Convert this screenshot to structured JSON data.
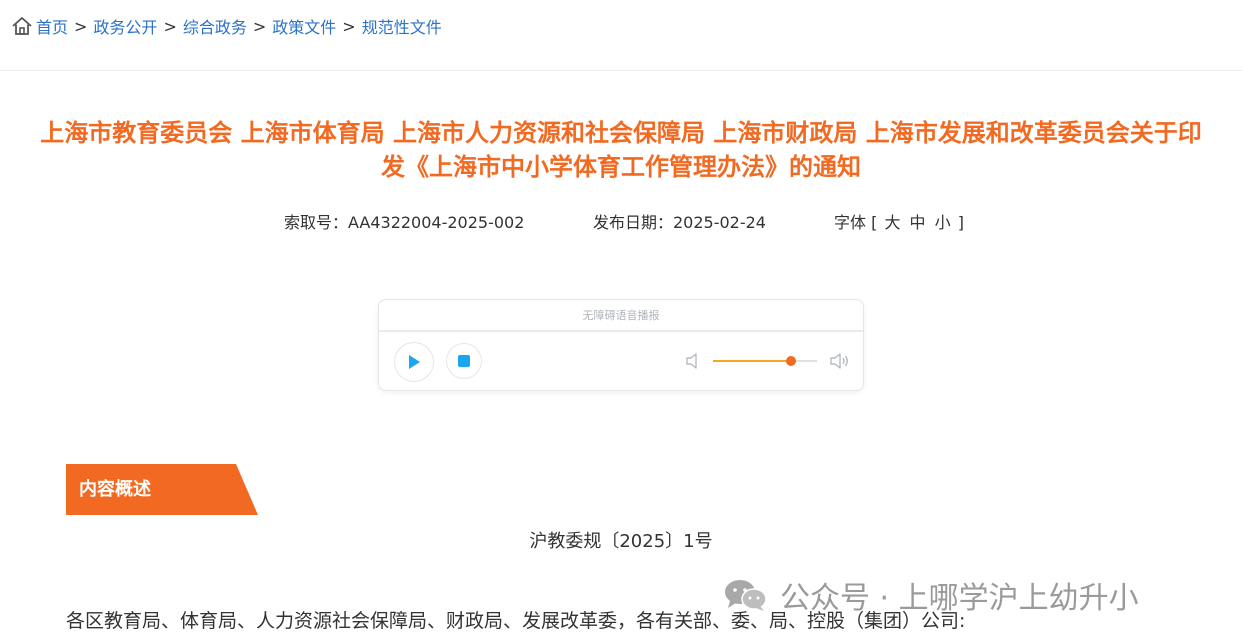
{
  "breadcrumb": {
    "items": [
      "首页",
      "政务公开",
      "综合政务",
      "政策文件",
      "规范性文件"
    ],
    "separator": ">"
  },
  "article": {
    "title_line1": "上海市教育委员会 上海市体育局 上海市人力资源和社会保障局 上海市财政局 上海市发展和改革委员会关于印",
    "title_line2": "发《上海市中小学体育工作管理办法》的通知",
    "index_label": "索取号：AA4322004-2025-002",
    "date_label": "发布日期：2025-02-24",
    "font_size_prefix": "字体 [",
    "font_size_options": [
      "大",
      "中",
      "小"
    ],
    "font_size_suffix": "]"
  },
  "player": {
    "title": "无障碍语音播报",
    "volume_level": 0.75,
    "accent_color": "#f26a21"
  },
  "content": {
    "section_label": "内容概述",
    "doc_number": "沪教委规〔2025〕1号",
    "recipients": "各区教育局、体育局、人力资源社会保障局、财政局、发展改革委，各有关部、委、局、控股（集团）公司:"
  },
  "watermark": {
    "text": "公众号 · 上哪学沪上幼升小"
  },
  "colors": {
    "title": "#f26a21",
    "link": "#2b72c8",
    "section_tag": "#f26a21",
    "play_icon": "#1aa7f0"
  }
}
